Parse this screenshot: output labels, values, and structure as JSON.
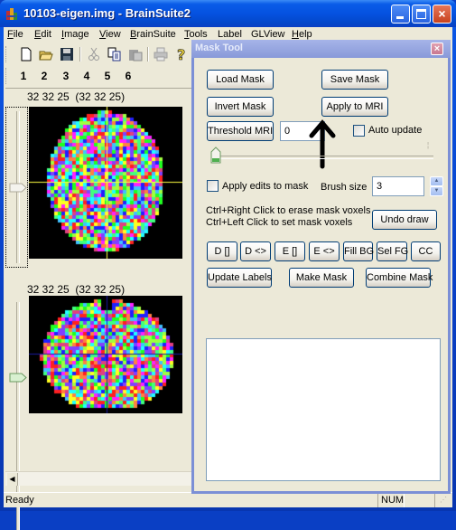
{
  "window": {
    "title": "10103-eigen.img - BrainSuite2",
    "controls": {
      "minimize": "minimize",
      "maximize": "maximize",
      "close": "×"
    }
  },
  "menubar": {
    "items": [
      {
        "label": "File",
        "accel": "F"
      },
      {
        "label": "Edit",
        "accel": "E"
      },
      {
        "label": "Image",
        "accel": "I"
      },
      {
        "label": "View",
        "accel": "V"
      },
      {
        "label": "BrainSuite",
        "accel": "B"
      },
      {
        "label": "Tools",
        "accel": "T"
      },
      {
        "label": "Label",
        "accel": ""
      },
      {
        "label": "GLView",
        "accel": ""
      },
      {
        "label": "Help",
        "accel": "H"
      }
    ]
  },
  "toolbar": {
    "icons": [
      "new-file-icon",
      "open-folder-icon",
      "save-disk-icon",
      "cut-icon",
      "copy-icon",
      "paste-icon",
      "print-icon",
      "help-icon"
    ]
  },
  "view_buttons": [
    "1",
    "2",
    "3",
    "4",
    "5",
    "6"
  ],
  "views": [
    {
      "name": "axial",
      "coords": "32 32 25",
      "coords_paren": "(32 32 25)",
      "crosshair_color": "#ffff40",
      "slider_fraction": 0.5
    },
    {
      "name": "coronal",
      "coords": "32 32 25",
      "coords_paren": "(32 32 25)",
      "crosshair_color": "#1a1aa0",
      "slider_fraction": 0.5
    }
  ],
  "status": {
    "text": "Ready",
    "num": "NUM"
  },
  "mask_tool": {
    "title": "Mask Tool",
    "close_glyph": "×",
    "load_mask": "Load Mask",
    "save_mask": "Save Mask",
    "invert_mask": "Invert Mask",
    "apply_to_mri": "Apply to MRI",
    "threshold_mri": "Threshold MRI",
    "threshold_value": "0",
    "auto_update": "Auto update",
    "auto_update_checked": false,
    "threshold_slider_fraction": 0.0,
    "apply_edits": "Apply edits to mask",
    "apply_edits_checked": false,
    "brush_size_label": "Brush size",
    "brush_size_value": "3",
    "hint_erase": "Ctrl+Right Click to erase mask voxels",
    "hint_set": "Ctrl+Left Click to set mask voxels",
    "undo_draw": "Undo draw",
    "morph_buttons": [
      "D []",
      "D <>",
      "E []",
      "E <>",
      "Fill BG",
      "Sel FG",
      "CC"
    ],
    "update_labels": "Update Labels",
    "make_mask": "Make Mask",
    "combine_mask": "Combine Mask"
  }
}
